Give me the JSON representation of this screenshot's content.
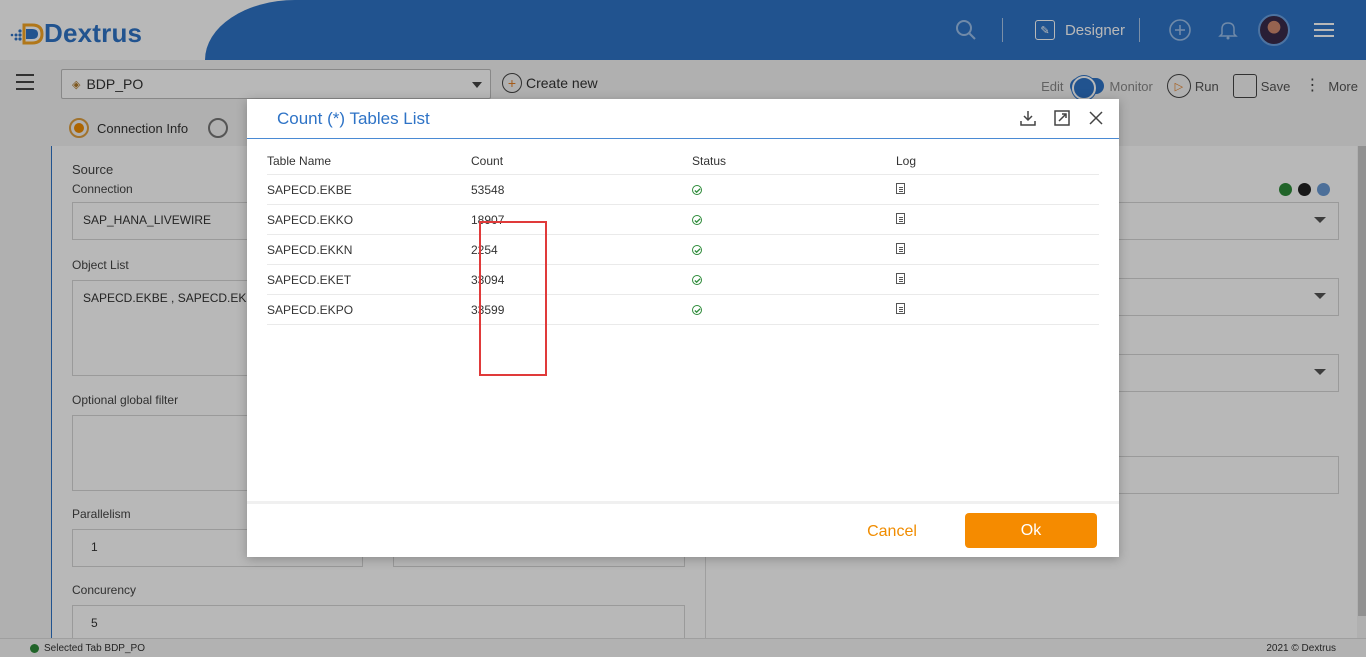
{
  "app": {
    "brand": "Dextrus",
    "mode_label": "Designer"
  },
  "toolbar": {
    "pipeline_name": "BDP_PO",
    "create_new": "Create new",
    "edit_label": "Edit",
    "monitor_label": "Monitor",
    "run_label": "Run",
    "save_label": "Save",
    "more_label": "More"
  },
  "tabs": {
    "connection_info": "Connection Info"
  },
  "form": {
    "source_label": "Source",
    "connection_label": "Connection",
    "connection_value": "SAP_HANA_LIVEWIRE",
    "object_list_label": "Object List",
    "object_list_value": "SAPECD.EKBE , SAPECD.EKE",
    "filter_label": "Optional global filter",
    "parallelism_label": "Parallelism",
    "parallelism_value": "1",
    "concurrency_label": "Concurency",
    "concurrency_value": "5"
  },
  "modal": {
    "title": "Count (*) Tables List",
    "columns": [
      "Table Name",
      "Count",
      "Status",
      "Log"
    ],
    "rows": [
      {
        "table": "SAPECD.EKBE",
        "count": "53548"
      },
      {
        "table": "SAPECD.EKKO",
        "count": "18907"
      },
      {
        "table": "SAPECD.EKKN",
        "count": "2254"
      },
      {
        "table": "SAPECD.EKET",
        "count": "33094"
      },
      {
        "table": "SAPECD.EKPO",
        "count": "33599"
      }
    ],
    "cancel_label": "Cancel",
    "ok_label": "Ok"
  },
  "statusbar": {
    "selected_tab": "Selected Tab BDP_PO",
    "copyright": "2021 © Dextrus"
  },
  "colors": {
    "brand_blue": "#2e73c6",
    "accent_orange": "#f58b00",
    "highlight_red": "#e03a3a",
    "status_green": "#2e8b3a"
  }
}
